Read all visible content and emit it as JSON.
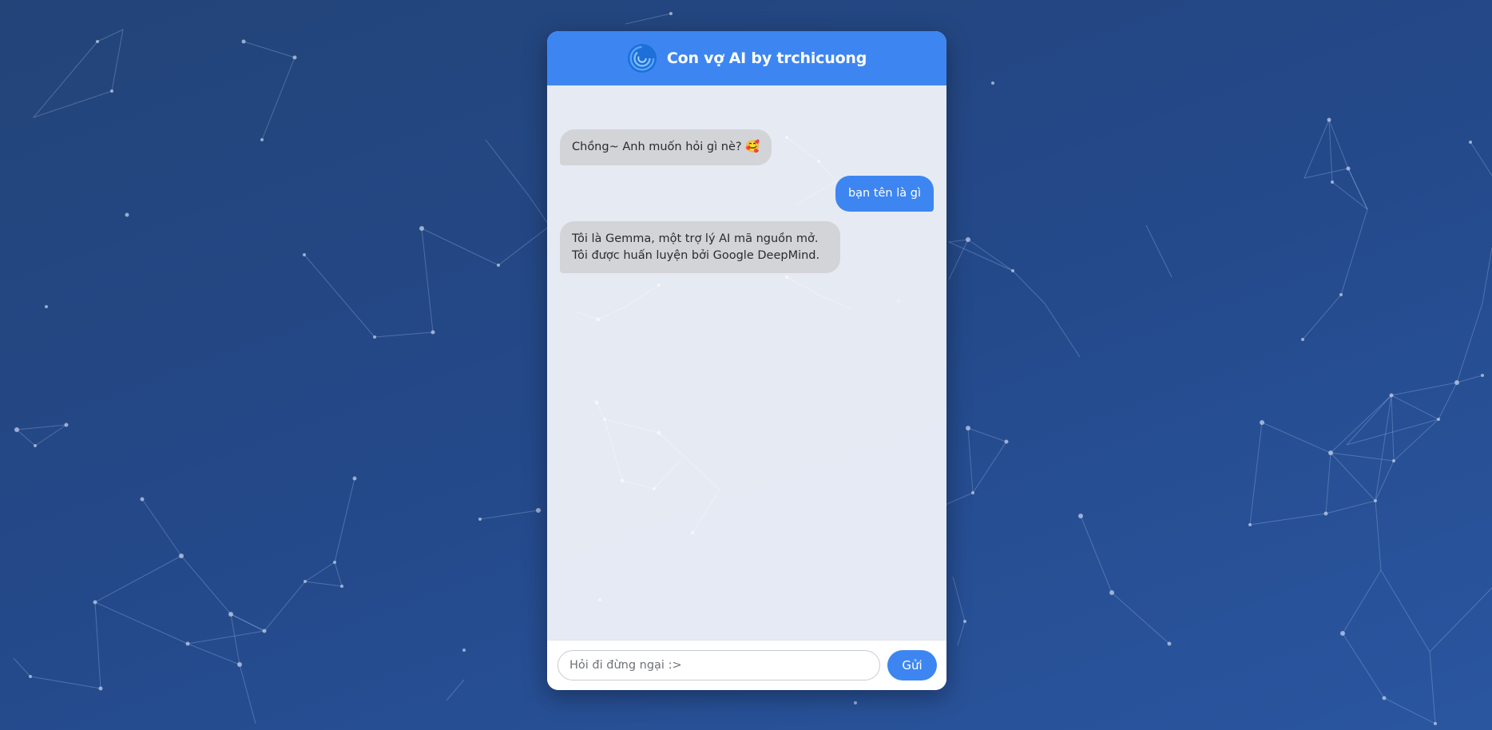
{
  "app": {
    "title": "Con vợ AI by trchicuong",
    "logo_icon": "blue-swirl-logo-icon"
  },
  "colors": {
    "accent": "#3d86f1",
    "background": "#24498a",
    "bot_bubble": "#d3d4d8"
  },
  "messages": [
    {
      "role": "bot",
      "text": "Chồng~ Anh muốn hỏi gì nè? 🥰"
    },
    {
      "role": "user",
      "text": "bạn tên là gì"
    },
    {
      "role": "bot",
      "text": "Tôi là Gemma, một trợ lý AI mã nguồn mở. Tôi được huấn luyện bởi Google DeepMind."
    }
  ],
  "input": {
    "placeholder": "Hỏi đi đừng ngại :>",
    "value": ""
  },
  "send_button": {
    "label": "Gửi"
  }
}
